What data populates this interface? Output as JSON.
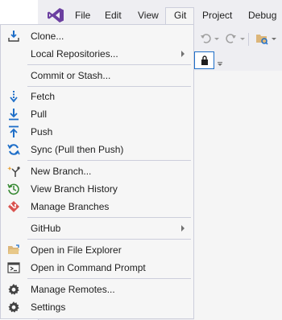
{
  "menubar": {
    "items": [
      "File",
      "Edit",
      "View",
      "Git",
      "Project",
      "Debug"
    ]
  },
  "git_menu": {
    "items": [
      {
        "label": "Clone...",
        "icon": "clone-icon"
      },
      {
        "label": "Local Repositories...",
        "icon": null,
        "submenu": true
      },
      {
        "label": "Commit or Stash...",
        "icon": null
      },
      {
        "label": "Fetch",
        "icon": "fetch-icon"
      },
      {
        "label": "Pull",
        "icon": "pull-icon"
      },
      {
        "label": "Push",
        "icon": "push-icon"
      },
      {
        "label": "Sync (Pull then Push)",
        "icon": "sync-icon"
      },
      {
        "label": "New Branch...",
        "icon": "new-branch-icon"
      },
      {
        "label": "View Branch History",
        "icon": "history-icon"
      },
      {
        "label": "Manage Branches",
        "icon": "manage-branches-icon"
      },
      {
        "label": "GitHub",
        "icon": null,
        "submenu": true
      },
      {
        "label": "Open in File Explorer",
        "icon": "folder-icon"
      },
      {
        "label": "Open in Command Prompt",
        "icon": "terminal-icon"
      },
      {
        "label": "Manage Remotes...",
        "icon": "gear-icon"
      },
      {
        "label": "Settings",
        "icon": "gear-icon"
      }
    ]
  },
  "colors": {
    "accent": "#1e6ec8",
    "vs_purple": "#6b3fa0",
    "menu_bg": "#f6f6f6",
    "chrome_bg": "#eeeef2"
  }
}
